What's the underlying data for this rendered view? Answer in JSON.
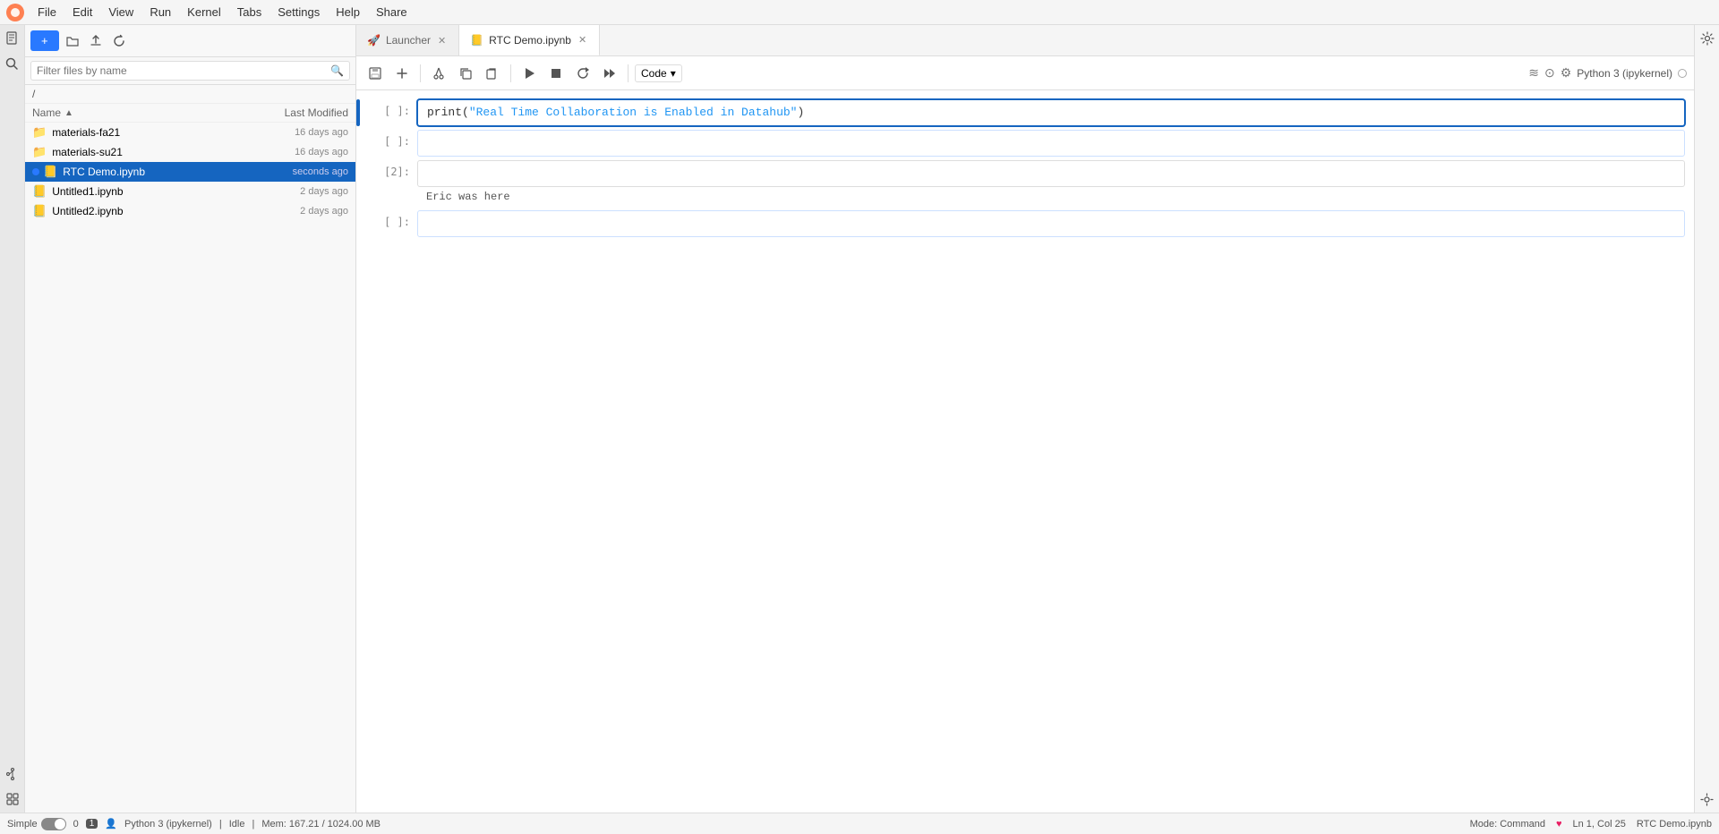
{
  "menubar": {
    "items": [
      "File",
      "Edit",
      "View",
      "Run",
      "Kernel",
      "Tabs",
      "Settings",
      "Help",
      "Share"
    ]
  },
  "sidebar_toolbar": {
    "new_button": "+",
    "open_folder_tooltip": "Open folder",
    "upload_tooltip": "Upload",
    "refresh_tooltip": "Refresh"
  },
  "search": {
    "placeholder": "Filter files by name"
  },
  "breadcrumb": "/",
  "file_list": {
    "columns": {
      "name": "Name",
      "modified": "Last Modified"
    },
    "sort_arrow": "▲",
    "items": [
      {
        "type": "folder",
        "name": "materials-fa21",
        "modified": "16 days ago",
        "running": false,
        "selected": false
      },
      {
        "type": "folder",
        "name": "materials-su21",
        "modified": "16 days ago",
        "running": false,
        "selected": false
      },
      {
        "type": "notebook",
        "name": "RTC Demo.ipynb",
        "modified": "seconds ago",
        "running": true,
        "selected": true
      },
      {
        "type": "notebook",
        "name": "Untitled1.ipynb",
        "modified": "2 days ago",
        "running": false,
        "selected": false
      },
      {
        "type": "notebook",
        "name": "Untitled2.ipynb",
        "modified": "2 days ago",
        "running": false,
        "selected": false
      }
    ]
  },
  "tabs": [
    {
      "id": "launcher",
      "label": "Launcher",
      "icon": "🚀",
      "active": false
    },
    {
      "id": "rtc-demo",
      "label": "RTC Demo.ipynb",
      "icon": "📒",
      "active": true
    }
  ],
  "notebook_toolbar": {
    "save": "💾",
    "add_cell": "+",
    "cut": "✂",
    "copy": "⧉",
    "paste": "❑",
    "run": "▶",
    "stop": "■",
    "restart": "↺",
    "fast_forward": "⏭",
    "cell_type": "Code",
    "cell_type_arrow": "▾"
  },
  "kernel_info": {
    "icons_left": "≋ ⊙",
    "name": "Python 3 (ipykernel)",
    "status_circle": "○"
  },
  "cells": [
    {
      "id": "cell1",
      "label": "[ ]:",
      "active": true,
      "type": "code",
      "content": "print(\"Real Time Collaboration is Enabled in Datahub\")",
      "output": null
    },
    {
      "id": "cell2",
      "label": "[ ]:",
      "active": false,
      "type": "code",
      "content": "",
      "output": null
    },
    {
      "id": "cell3",
      "label": "[2]:",
      "active": false,
      "type": "output",
      "content": "",
      "output": "Eric was here"
    },
    {
      "id": "cell4",
      "label": "[ ]:",
      "active": false,
      "type": "code",
      "content": "",
      "output": null
    }
  ],
  "status_bar": {
    "simple_label": "Simple",
    "error_count": "0",
    "status_badge": "1",
    "kernel_name": "Python 3 (ipykernel)",
    "kernel_state": "Idle",
    "memory": "Mem: 167.21 / 1024.00 MB",
    "mode": "Mode: Command",
    "position": "Ln 1, Col 25",
    "notebook_name": "RTC Demo.ipynb"
  }
}
